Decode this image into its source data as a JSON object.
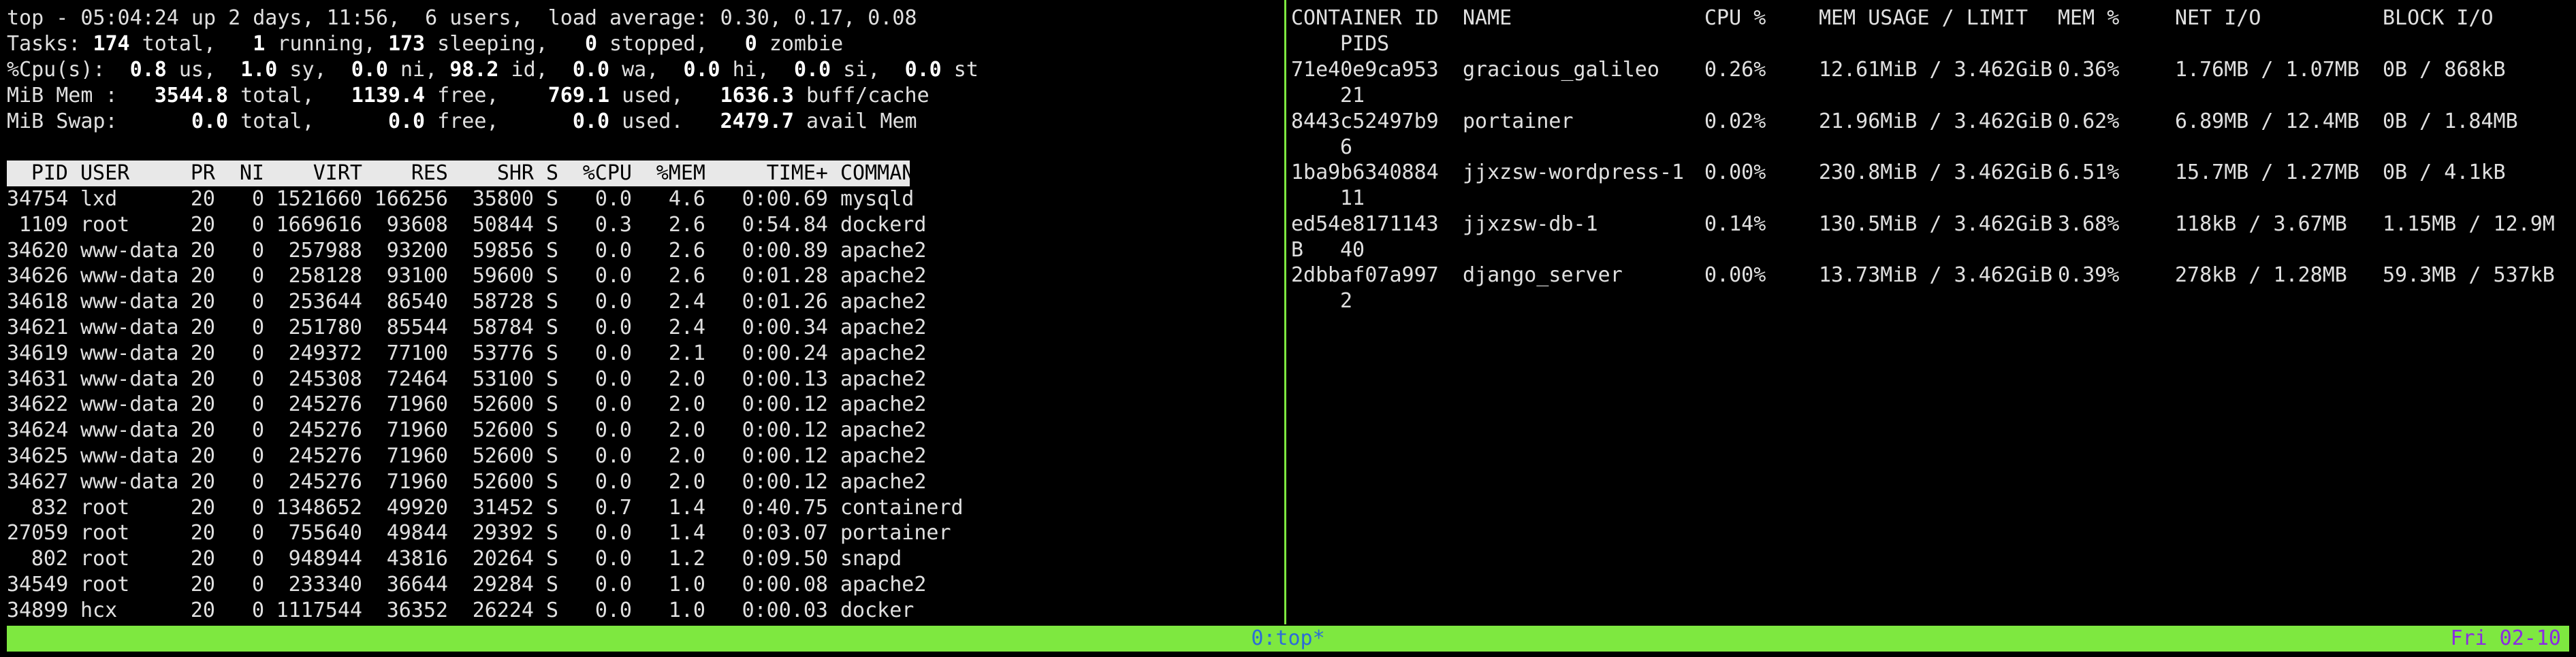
{
  "top": {
    "summary": {
      "line1": "top - 05:04:24 up 2 days, 11:56,  6 users,  load average: 0.30, 0.17, 0.08",
      "tasks_label": "Tasks: ",
      "tasks_total": "174",
      "tasks_total_lbl": " total,   ",
      "tasks_running": "1",
      "tasks_running_lbl": " running, ",
      "tasks_sleeping": "173",
      "tasks_sleeping_lbl": " sleeping,   ",
      "tasks_stopped": "0",
      "tasks_stopped_lbl": " stopped,   ",
      "tasks_zombie": "0",
      "tasks_zombie_lbl": " zombie",
      "cpu_label": "%Cpu(s):  ",
      "cpu_us": "0.8",
      "cpu_us_lbl": " us,  ",
      "cpu_sy": "1.0",
      "cpu_sy_lbl": " sy,  ",
      "cpu_ni": "0.0",
      "cpu_ni_lbl": " ni, ",
      "cpu_id": "98.2",
      "cpu_id_lbl": " id,  ",
      "cpu_wa": "0.0",
      "cpu_wa_lbl": " wa,  ",
      "cpu_hi": "0.0",
      "cpu_hi_lbl": " hi,  ",
      "cpu_si": "0.0",
      "cpu_si_lbl": " si,  ",
      "cpu_st": "0.0",
      "cpu_st_lbl": " st",
      "mem_label": "MiB Mem :   ",
      "mem_total": "3544.8",
      "mem_total_lbl": " total,   ",
      "mem_free": "1139.4",
      "mem_free_lbl": " free,    ",
      "mem_used": "769.1",
      "mem_used_lbl": " used,   ",
      "mem_cache": "1636.3",
      "mem_cache_lbl": " buff/cache",
      "swap_label": "MiB Swap:      ",
      "swap_total": "0.0",
      "swap_total_lbl": " total,      ",
      "swap_free": "0.0",
      "swap_free_lbl": " free,      ",
      "swap_used": "0.0",
      "swap_used_lbl": " used.   ",
      "swap_avail": "2479.7",
      "swap_avail_lbl": " avail Mem"
    },
    "columns": [
      "PID",
      "USER",
      "PR",
      "NI",
      "VIRT",
      "RES",
      "SHR",
      "S",
      "%CPU",
      "%MEM",
      "TIME+",
      "COMMAND"
    ],
    "processes": [
      [
        "34754",
        "lxd",
        "20",
        "0",
        "1521660",
        "166256",
        "35800",
        "S",
        "0.0",
        "4.6",
        "0:00.69",
        "mysqld"
      ],
      [
        "1109",
        "root",
        "20",
        "0",
        "1669616",
        "93608",
        "50844",
        "S",
        "0.3",
        "2.6",
        "0:54.84",
        "dockerd"
      ],
      [
        "34620",
        "www-data",
        "20",
        "0",
        "257988",
        "93200",
        "59856",
        "S",
        "0.0",
        "2.6",
        "0:00.89",
        "apache2"
      ],
      [
        "34626",
        "www-data",
        "20",
        "0",
        "258128",
        "93100",
        "59600",
        "S",
        "0.0",
        "2.6",
        "0:01.28",
        "apache2"
      ],
      [
        "34618",
        "www-data",
        "20",
        "0",
        "253644",
        "86540",
        "58728",
        "S",
        "0.0",
        "2.4",
        "0:01.26",
        "apache2"
      ],
      [
        "34621",
        "www-data",
        "20",
        "0",
        "251780",
        "85544",
        "58784",
        "S",
        "0.0",
        "2.4",
        "0:00.34",
        "apache2"
      ],
      [
        "34619",
        "www-data",
        "20",
        "0",
        "249372",
        "77100",
        "53776",
        "S",
        "0.0",
        "2.1",
        "0:00.24",
        "apache2"
      ],
      [
        "34631",
        "www-data",
        "20",
        "0",
        "245308",
        "72464",
        "53100",
        "S",
        "0.0",
        "2.0",
        "0:00.13",
        "apache2"
      ],
      [
        "34622",
        "www-data",
        "20",
        "0",
        "245276",
        "71960",
        "52600",
        "S",
        "0.0",
        "2.0",
        "0:00.12",
        "apache2"
      ],
      [
        "34624",
        "www-data",
        "20",
        "0",
        "245276",
        "71960",
        "52600",
        "S",
        "0.0",
        "2.0",
        "0:00.12",
        "apache2"
      ],
      [
        "34625",
        "www-data",
        "20",
        "0",
        "245276",
        "71960",
        "52600",
        "S",
        "0.0",
        "2.0",
        "0:00.12",
        "apache2"
      ],
      [
        "34627",
        "www-data",
        "20",
        "0",
        "245276",
        "71960",
        "52600",
        "S",
        "0.0",
        "2.0",
        "0:00.12",
        "apache2"
      ],
      [
        "832",
        "root",
        "20",
        "0",
        "1348652",
        "49920",
        "31452",
        "S",
        "0.7",
        "1.4",
        "0:40.75",
        "containerd"
      ],
      [
        "27059",
        "root",
        "20",
        "0",
        "755640",
        "49844",
        "29392",
        "S",
        "0.0",
        "1.4",
        "0:03.07",
        "portainer"
      ],
      [
        "802",
        "root",
        "20",
        "0",
        "948944",
        "43816",
        "20264",
        "S",
        "0.0",
        "1.2",
        "0:09.50",
        "snapd"
      ],
      [
        "34549",
        "root",
        "20",
        "0",
        "233340",
        "36644",
        "29284",
        "S",
        "0.0",
        "1.0",
        "0:00.08",
        "apache2"
      ],
      [
        "34899",
        "hcx",
        "20",
        "0",
        "1117544",
        "36352",
        "26224",
        "S",
        "0.0",
        "1.0",
        "0:00.03",
        "docker"
      ]
    ]
  },
  "docker": {
    "columns": [
      "CONTAINER ID",
      "NAME",
      "CPU %",
      "MEM USAGE / LIMIT",
      "MEM %",
      "NET I/O",
      "BLOCK I/O"
    ],
    "pids_header": "PIDS",
    "containers": [
      {
        "id": "71e40e9ca953",
        "name": "gracious_galileo",
        "cpu": "0.26%",
        "mem": "12.61MiB / 3.462GiB",
        "mem_pct": "0.36%",
        "net": "1.76MB / 1.07MB",
        "block": "0B / 868kB",
        "pids": "21"
      },
      {
        "id": "8443c52497b9",
        "name": "portainer",
        "cpu": "0.02%",
        "mem": "21.96MiB / 3.462GiB",
        "mem_pct": "0.62%",
        "net": "6.89MB / 12.4MB",
        "block": "0B / 1.84MB",
        "pids": "6"
      },
      {
        "id": "1ba9b6340884",
        "name": "jjxzsw-wordpress-1",
        "cpu": "0.00%",
        "mem": "230.8MiB / 3.462GiB",
        "mem_pct": "6.51%",
        "net": "15.7MB / 1.27MB",
        "block": "0B / 4.1kB",
        "pids": "11"
      },
      {
        "id": "ed54e8171143",
        "name": "jjxzsw-db-1",
        "cpu": "0.14%",
        "mem": "130.5MiB / 3.462GiB",
        "mem_pct": "3.68%",
        "net": "118kB / 3.67MB",
        "block": "1.15MB / 12.9M",
        "block_wrap": "B",
        "pids": "40"
      },
      {
        "id": "2dbbaf07a997",
        "name": "django_server",
        "cpu": "0.00%",
        "mem": "13.73MiB / 3.462GiB",
        "mem_pct": "0.39%",
        "net": "278kB / 1.28MB",
        "block": "59.3MB / 537kB",
        "pids": "2"
      }
    ]
  },
  "status_bar": {
    "window": "0:top*",
    "date": "Fri 02-10"
  },
  "colors": {
    "background": "#000000",
    "text": "#e0e0e0",
    "tmux_green": "#7ee840",
    "window_blue": "#2d6bd8",
    "date_purple": "#8a2be2"
  }
}
